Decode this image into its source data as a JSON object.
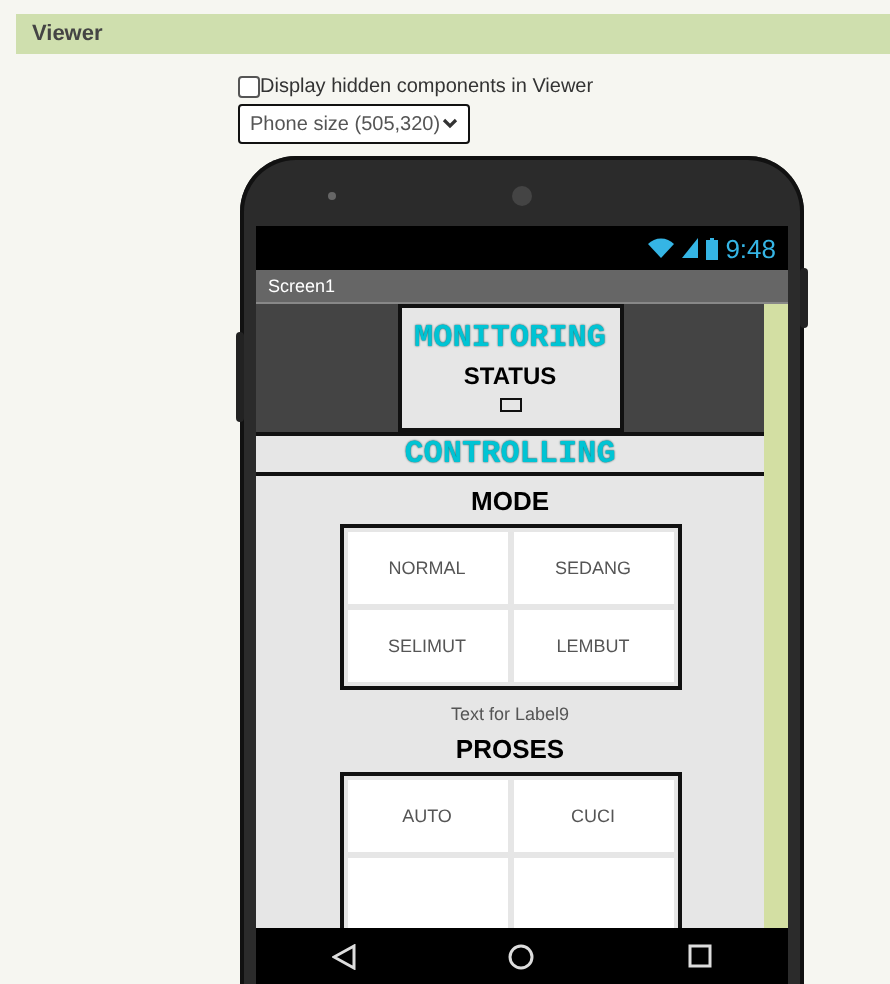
{
  "panel": {
    "title": "Viewer"
  },
  "hidden_toggle": {
    "label": "Display hidden components in Viewer",
    "checked": false
  },
  "size_select": {
    "value": "Phone size (505,320)"
  },
  "phone": {
    "time": "9:48",
    "screen_title": "Screen1",
    "monitoring": {
      "title": "MONITORING",
      "status": "STATUS"
    },
    "controlling": {
      "title": "CONTROLLING"
    },
    "mode": {
      "title": "MODE",
      "buttons": [
        {
          "kind": "button",
          "label": "NORMAL"
        },
        {
          "kind": "button",
          "label": "SEDANG"
        },
        {
          "kind": "button",
          "label": "SELIMUT"
        },
        {
          "kind": "button",
          "label": "LEMBUT"
        }
      ]
    },
    "label9": "Text for Label9",
    "proses": {
      "title": "PROSES",
      "buttons": [
        {
          "kind": "button",
          "label": "AUTO"
        },
        {
          "kind": "button",
          "label": "CUCI"
        },
        {
          "kind": "cut"
        },
        {
          "kind": "cut"
        }
      ]
    }
  }
}
